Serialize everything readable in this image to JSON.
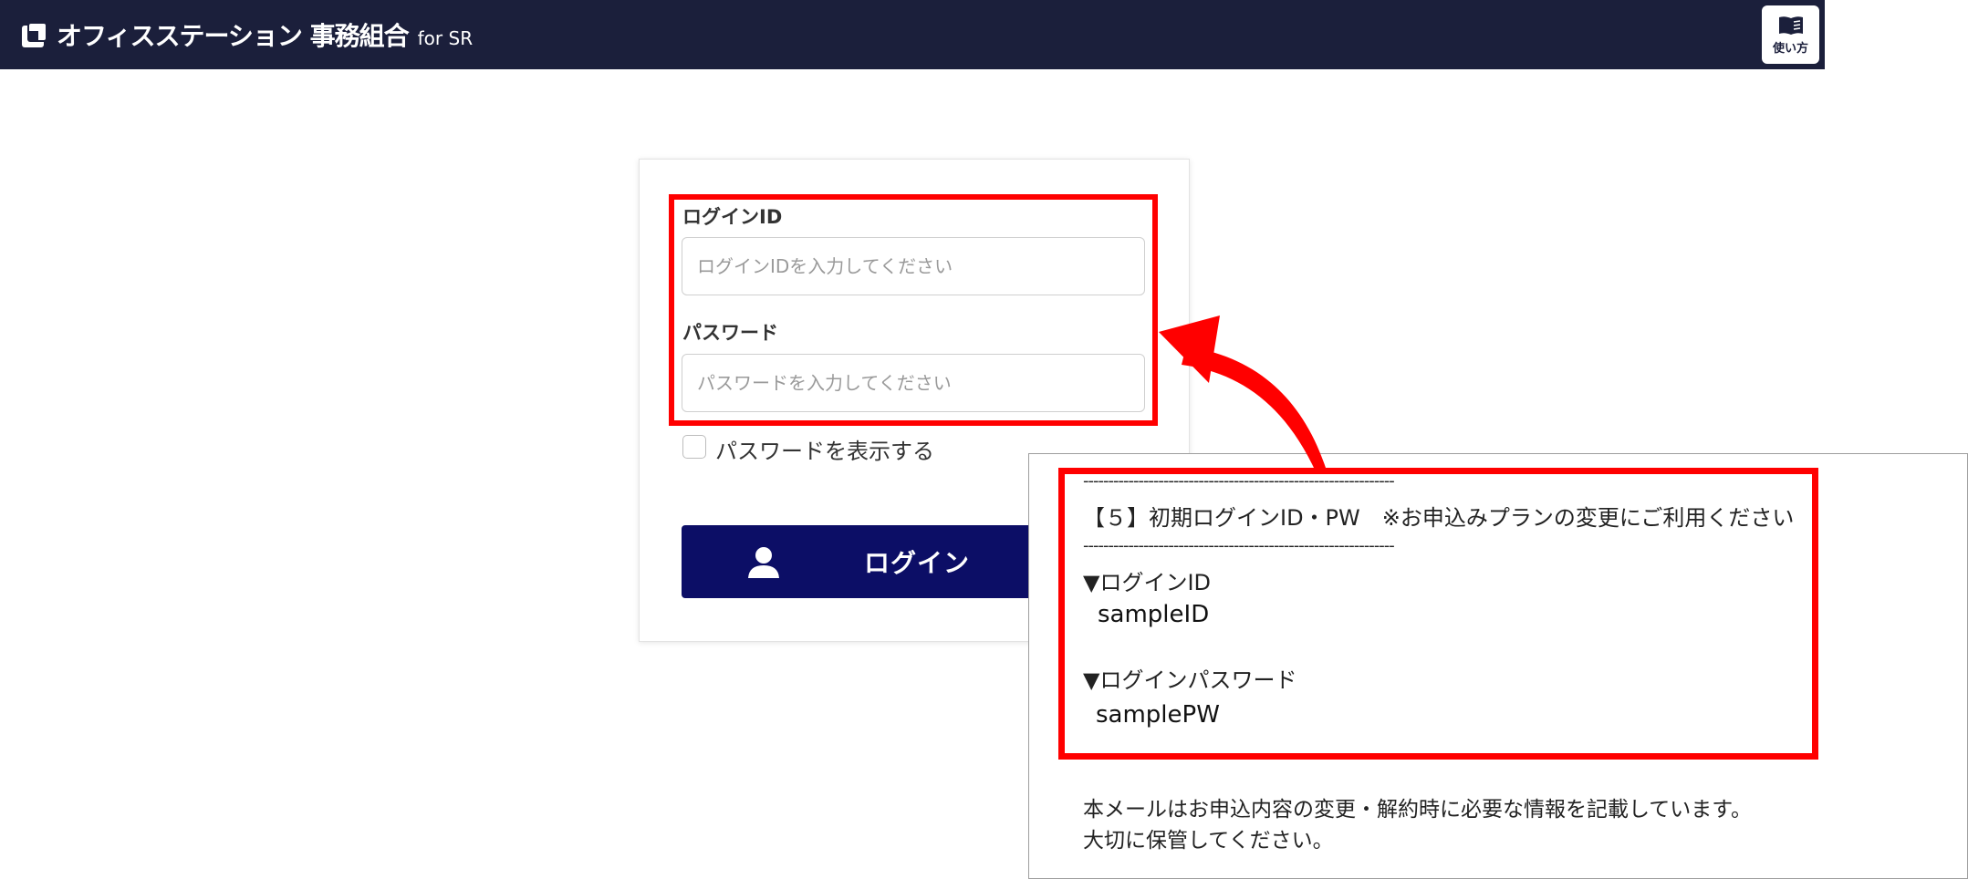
{
  "header": {
    "brand_main": "オフィスステーション 事務組合",
    "brand_sub": "for SR",
    "help_label": "使い方",
    "bg_color": "#1b1f3b"
  },
  "login_form": {
    "id_label": "ログインID",
    "id_placeholder": "ログインIDを入力してください",
    "password_label": "パスワード",
    "password_placeholder": "パスワードを入力してください",
    "show_password_label": "パスワードを表示する",
    "login_button": "ログイン",
    "button_color": "#0c0e66"
  },
  "email_excerpt": {
    "divider": "--------------------------------------------------------------",
    "heading": "【５】初期ログインID・PW　※お申込みプランの変更にご利用ください",
    "id_heading": "▼ログインID",
    "id_value": "sampleID",
    "pw_heading": "▼ログインパスワード",
    "pw_value": "samplePW",
    "note_line1": "本メールはお申込内容の変更・解約時に必要な情報を記載しています。",
    "note_line2": "大切に保管してください。"
  },
  "annotation": {
    "highlight_color": "#ff0000"
  }
}
